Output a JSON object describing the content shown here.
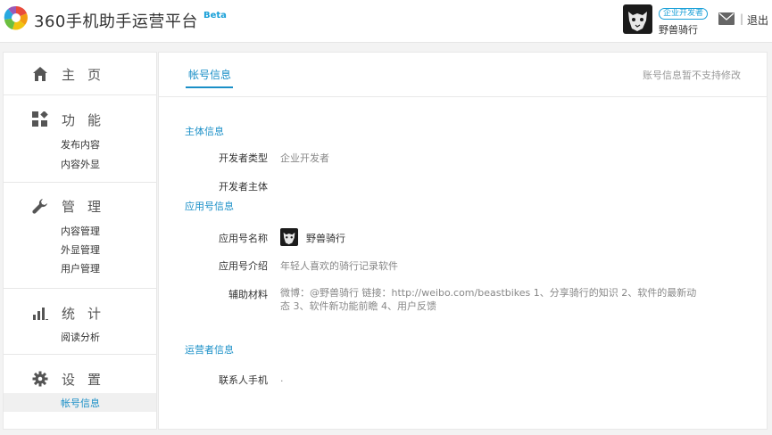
{
  "header": {
    "brand": "360手机助手运营平台",
    "beta": "Beta",
    "dev_badge": "企业开发者",
    "username": "野兽骑行",
    "separator": "|",
    "logout": "退出"
  },
  "sidebar": {
    "home": "主页",
    "features": {
      "title": "功能",
      "items": [
        "发布内容",
        "内容外显"
      ]
    },
    "manage": {
      "title": "管理",
      "items": [
        "内容管理",
        "外显管理",
        "用户管理"
      ]
    },
    "stats": {
      "title": "统计",
      "items": [
        "阅读分析"
      ]
    },
    "settings": {
      "title": "设置",
      "items": [
        "帐号信息"
      ]
    }
  },
  "main": {
    "tab": "帐号信息",
    "notice": "账号信息暂不支持修改",
    "subject": {
      "title": "主体信息",
      "dev_type_label": "开发者类型",
      "dev_type_value": "企业开发者",
      "dev_entity_label": "开发者主体",
      "dev_entity_value": ""
    },
    "app": {
      "title": "应用号信息",
      "name_label": "应用号名称",
      "name_value": "野兽骑行",
      "intro_label": "应用号介绍",
      "intro_value": "年轻人喜欢的骑行记录软件",
      "material_label": "辅助材料",
      "material_value": "微博：@野兽骑行 链接：http://weibo.com/beastbikes 1、分享骑行的知识 2、软件的最新动态 3、软件新功能前瞻 4、用户反馈"
    },
    "operator": {
      "title": "运营者信息",
      "phone_label": "联系人手机",
      "phone_value": "."
    }
  }
}
